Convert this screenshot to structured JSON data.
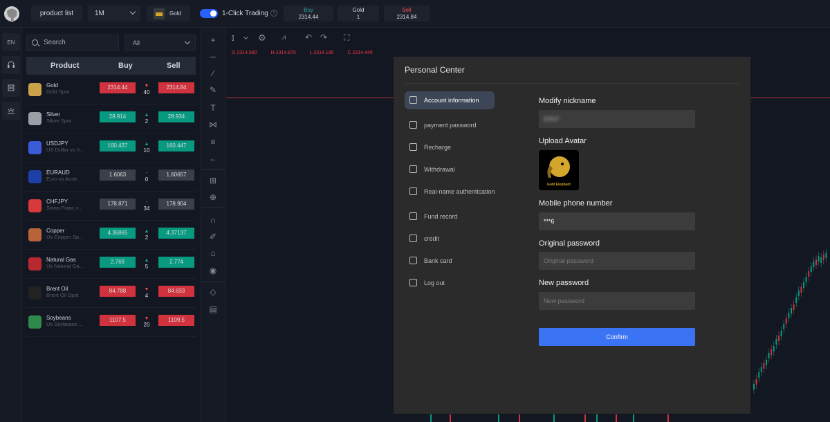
{
  "topbar": {
    "product_list_label": "product list",
    "timeframe": "1M",
    "symbol": "Gold",
    "one_click_label": "1-Click Trading",
    "one_click_on": true,
    "quote_buy_label": "Buy",
    "quote_buy_value": "2314.44",
    "quote_symbol_label": "Gold",
    "quote_symbol_value": "1",
    "quote_sell_label": "Sell",
    "quote_sell_value": "2314.84"
  },
  "rail": {
    "lang": "EN"
  },
  "products": {
    "search_placeholder": "Search",
    "filter_value": "All",
    "headers": {
      "product": "Product",
      "buy": "Buy",
      "sell": "Sell"
    },
    "rows": [
      {
        "name": "Gold",
        "sub": "Gold Spot",
        "buy": "2314.44",
        "spread": "40",
        "sell": "2314.84",
        "trend": "down",
        "color": "#c9a24a"
      },
      {
        "name": "Silver",
        "sub": "Silver Spot",
        "buy": "28.914",
        "spread": "2",
        "sell": "28.934",
        "trend": "up",
        "color": "#9aa0a6"
      },
      {
        "name": "USDJPY",
        "sub": "US Dollar vs Y...",
        "buy": "160.437",
        "spread": "10",
        "sell": "160.447",
        "trend": "up",
        "color": "#3c5bd6"
      },
      {
        "name": "EURAUD",
        "sub": "Euro vs Austr...",
        "buy": "1.6063",
        "spread": "0",
        "sell": "1.60657",
        "trend": "flat",
        "color": "#1f3fa8"
      },
      {
        "name": "CHFJPY",
        "sub": "Swiss Franc v...",
        "buy": "178.871",
        "spread": "34",
        "sell": "178.904",
        "trend": "flat",
        "color": "#d63a3a"
      },
      {
        "name": "Copper",
        "sub": "Us Copper Sp...",
        "buy": "4.36865",
        "spread": "2",
        "sell": "4.37137",
        "trend": "up",
        "color": "#b8633a"
      },
      {
        "name": "Natural Gas",
        "sub": "Us Natural Ga...",
        "buy": "2.769",
        "spread": "5",
        "sell": "2.774",
        "trend": "up",
        "color": "#b8282e"
      },
      {
        "name": "Brent Oil",
        "sub": "Brent Oil Spot",
        "buy": "84.788",
        "spread": "4",
        "sell": "84.833",
        "trend": "down",
        "color": "#222222"
      },
      {
        "name": "Soybeans",
        "sub": "Us Soybeans ...",
        "buy": "1107.5",
        "spread": "20",
        "sell": "1109.5",
        "trend": "down",
        "color": "#2d8a4a"
      }
    ]
  },
  "chart": {
    "ohlc": {
      "o": "O 2314.580",
      "h": "H 2314.870",
      "l": "L 2314.190",
      "c": "C 2314.440"
    }
  },
  "colors": {
    "up": "#089981",
    "down": "#d0333e",
    "flat": "#3b3f49",
    "accent": "#3b73f5"
  },
  "modal": {
    "title": "Personal Center",
    "menu": [
      {
        "label": "Account information",
        "icon": "document-icon",
        "active": true
      },
      {
        "label": "payment password",
        "icon": "lock-card-icon",
        "active": false
      },
      {
        "label": "Recharge",
        "icon": "tag-icon",
        "active": false
      },
      {
        "label": "Withdrawal",
        "icon": "wallet-icon",
        "active": false
      },
      {
        "label": "Real-name authentication",
        "icon": "id-icon",
        "active": false
      },
      {
        "label": "Fund record",
        "icon": "clock-icon",
        "active": false
      },
      {
        "label": "credit",
        "icon": "credit-icon",
        "active": false
      },
      {
        "label": "Bank card",
        "icon": "bank-card-icon",
        "active": false
      },
      {
        "label": "Log out",
        "icon": "logout-icon",
        "active": false
      }
    ],
    "nickname_label": "Modify nickname",
    "nickname_value": "8353*",
    "avatar_label": "Upload Avatar",
    "avatar_brand": "Gold Elephant",
    "phone_label": "Mobile phone number",
    "phone_value": "***6",
    "orig_pwd_label": "Original password",
    "orig_pwd_placeholder": "Original password",
    "new_pwd_label": "New password",
    "new_pwd_placeholder": "New password",
    "confirm_label": "Confirm"
  }
}
